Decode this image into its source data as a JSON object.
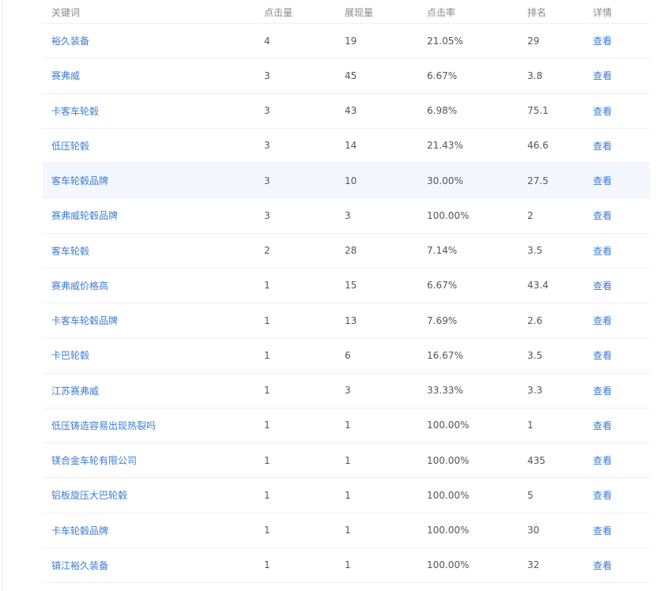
{
  "table": {
    "headers": {
      "keyword": "关键词",
      "clicks": "点击量",
      "impressions": "展现量",
      "ctr": "点击率",
      "rank": "排名",
      "detail": "详情"
    },
    "rows": [
      {
        "keyword": "裕久装备",
        "clicks": "4",
        "impressions": "19",
        "ctr": "21.05%",
        "rank": "29",
        "detail": "查看"
      },
      {
        "keyword": "赛弗威",
        "clicks": "3",
        "impressions": "45",
        "ctr": "6.67%",
        "rank": "3.8",
        "detail": "查看"
      },
      {
        "keyword": "卡客车轮毂",
        "clicks": "3",
        "impressions": "43",
        "ctr": "6.98%",
        "rank": "75.1",
        "detail": "查看"
      },
      {
        "keyword": "低压轮毂",
        "clicks": "3",
        "impressions": "14",
        "ctr": "21.43%",
        "rank": "46.6",
        "detail": "查看"
      },
      {
        "keyword": "客车轮毂品牌",
        "clicks": "3",
        "impressions": "10",
        "ctr": "30.00%",
        "rank": "27.5",
        "detail": "查看"
      },
      {
        "keyword": "赛弗威轮毂品牌",
        "clicks": "3",
        "impressions": "3",
        "ctr": "100.00%",
        "rank": "2",
        "detail": "查看"
      },
      {
        "keyword": "客车轮毂",
        "clicks": "2",
        "impressions": "28",
        "ctr": "7.14%",
        "rank": "3.5",
        "detail": "查看"
      },
      {
        "keyword": "赛弗威价格高",
        "clicks": "1",
        "impressions": "15",
        "ctr": "6.67%",
        "rank": "43.4",
        "detail": "查看"
      },
      {
        "keyword": "卡客车轮毂品牌",
        "clicks": "1",
        "impressions": "13",
        "ctr": "7.69%",
        "rank": "2.6",
        "detail": "查看"
      },
      {
        "keyword": "卡巴轮毂",
        "clicks": "1",
        "impressions": "6",
        "ctr": "16.67%",
        "rank": "3.5",
        "detail": "查看"
      },
      {
        "keyword": "江苏赛弗威",
        "clicks": "1",
        "impressions": "3",
        "ctr": "33.33%",
        "rank": "3.3",
        "detail": "查看"
      },
      {
        "keyword": "低压铸造容易出现热裂吗",
        "clicks": "1",
        "impressions": "1",
        "ctr": "100.00%",
        "rank": "1",
        "detail": "查看"
      },
      {
        "keyword": "镁合金车轮有限公司",
        "clicks": "1",
        "impressions": "1",
        "ctr": "100.00%",
        "rank": "435",
        "detail": "查看"
      },
      {
        "keyword": "铝板旋压大巴轮毂",
        "clicks": "1",
        "impressions": "1",
        "ctr": "100.00%",
        "rank": "5",
        "detail": "查看"
      },
      {
        "keyword": "卡车轮毂品牌",
        "clicks": "1",
        "impressions": "1",
        "ctr": "100.00%",
        "rank": "30",
        "detail": "查看"
      },
      {
        "keyword": "镇江裕久装备",
        "clicks": "1",
        "impressions": "1",
        "ctr": "100.00%",
        "rank": "32",
        "detail": "查看"
      }
    ]
  },
  "colors": {
    "link": "#3b7bd4",
    "highlight_row": "#f4f8fe",
    "divider": "#eef0f3"
  }
}
